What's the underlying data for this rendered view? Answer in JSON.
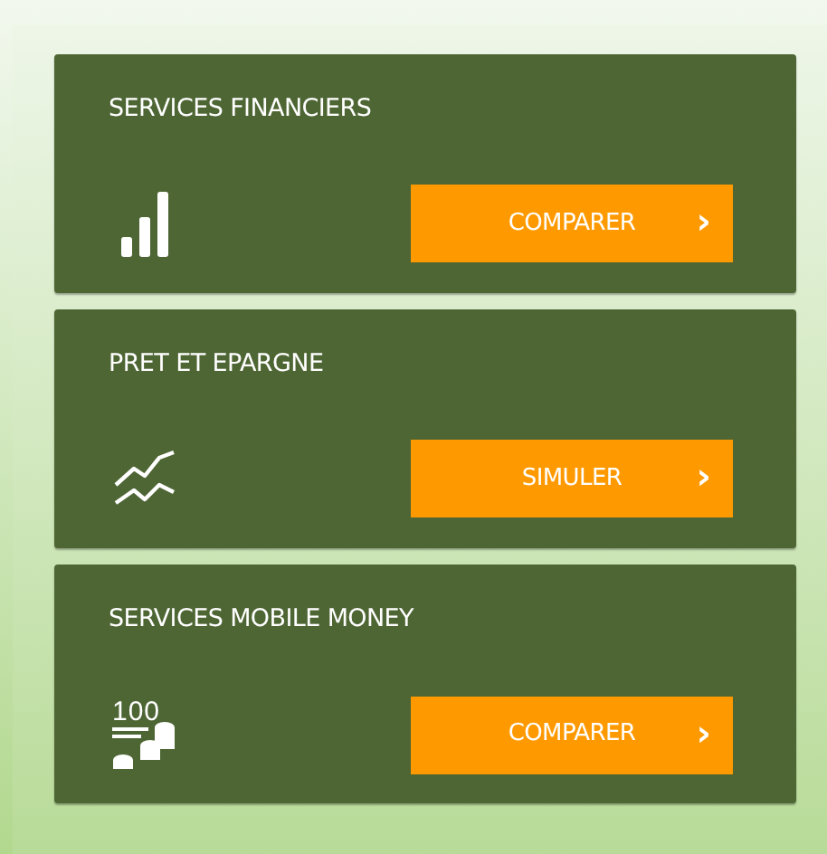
{
  "cards": [
    {
      "title": "SERVICES FINANCIERS",
      "icon": {
        "kind": "bars"
      },
      "button": {
        "label": "COMPARER",
        "arrow": "›"
      }
    },
    {
      "title": "PRET ET EPARGNE",
      "icon": {
        "kind": "trend"
      },
      "button": {
        "label": "SIMULER",
        "arrow": "›"
      }
    },
    {
      "title": "SERVICES MOBILE MONEY",
      "icon": {
        "kind": "coins",
        "text": "100"
      },
      "button": {
        "label": "COMPARER",
        "arrow": "›"
      }
    }
  ]
}
